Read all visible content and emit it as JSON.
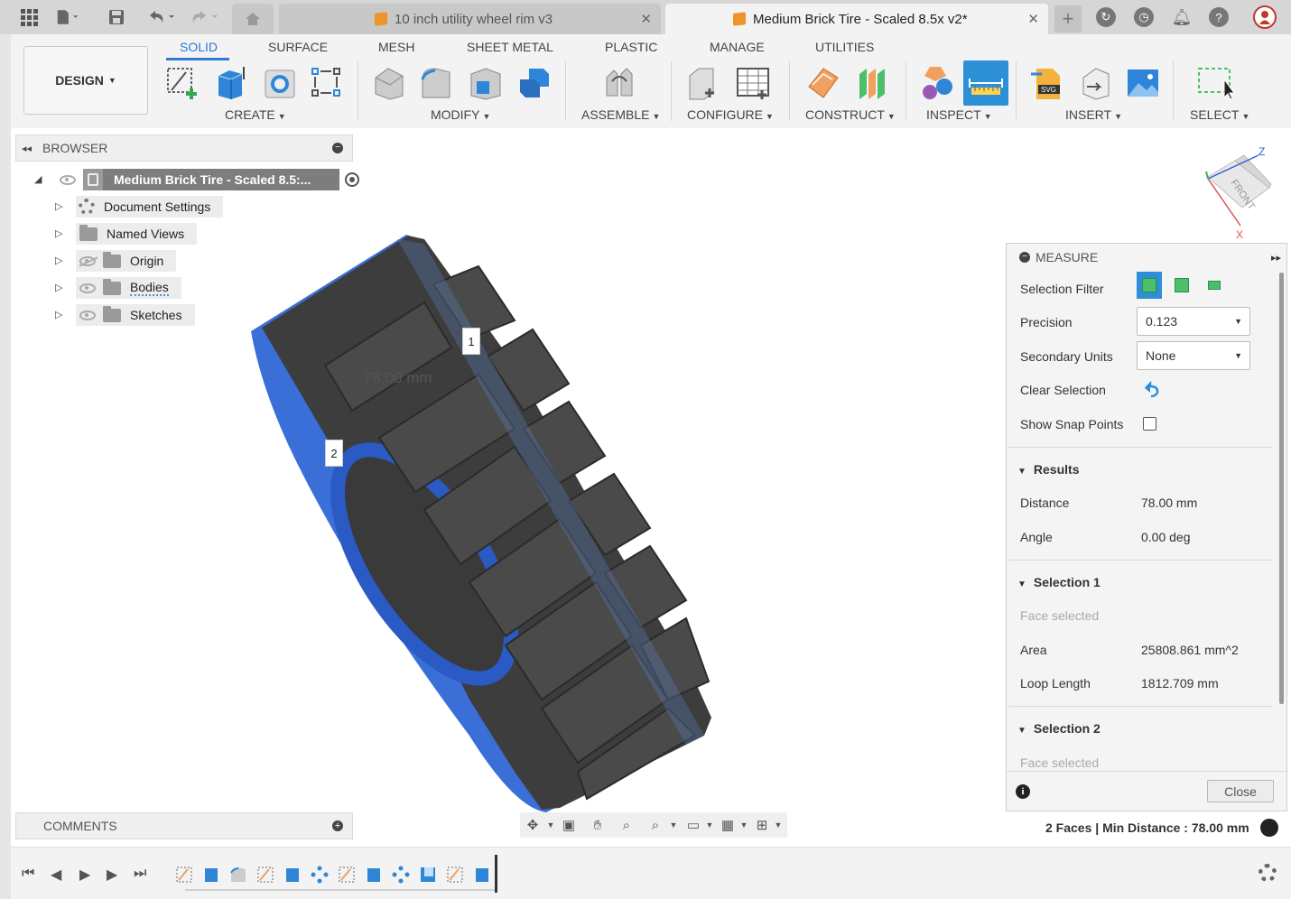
{
  "tabs": {
    "inactive_title": "10 inch utility wheel rim v3",
    "active_title": "Medium Brick Tire - Scaled 8.5x v2*"
  },
  "toolbar": {
    "design_label": "DESIGN",
    "workspace_tabs": [
      "SOLID",
      "SURFACE",
      "MESH",
      "SHEET METAL",
      "PLASTIC",
      "MANAGE",
      "UTILITIES"
    ],
    "groups": {
      "create": "CREATE",
      "modify": "MODIFY",
      "assemble": "ASSEMBLE",
      "configure": "CONFIGURE",
      "construct": "CONSTRUCT",
      "inspect": "INSPECT",
      "insert": "INSERT",
      "select": "SELECT"
    }
  },
  "browser": {
    "title": "BROWSER",
    "root": "Medium Brick Tire - Scaled 8.5:...",
    "items": [
      "Document Settings",
      "Named Views",
      "Origin",
      "Bodies",
      "Sketches"
    ]
  },
  "viewcube": {
    "face": "FRONT",
    "axis_z": "Z"
  },
  "viewport": {
    "dimension": "78.00 mm",
    "point1": "1",
    "point2": "2"
  },
  "measure": {
    "title": "MEASURE",
    "selection_filter_label": "Selection Filter",
    "precision_label": "Precision",
    "precision_value": "0.123",
    "secondary_units_label": "Secondary Units",
    "secondary_units_value": "None",
    "clear_selection_label": "Clear Selection",
    "show_snap_label": "Show Snap Points",
    "results_title": "Results",
    "distance_label": "Distance",
    "distance_value": "78.00 mm",
    "angle_label": "Angle",
    "angle_value": "0.00 deg",
    "sel1_title": "Selection 1",
    "sel1_type": "Face selected",
    "area_label": "Area",
    "area_value": "25808.861 mm^2",
    "loop_label": "Loop Length",
    "loop_value": "1812.709 mm",
    "sel2_title": "Selection 2",
    "sel2_type": "Face selected",
    "close_label": "Close"
  },
  "status": {
    "text": "2 Faces | Min Distance : 78.00 mm"
  },
  "comments": {
    "title": "COMMENTS"
  },
  "colors": {
    "accent": "#2d7bd6",
    "tire": "#3a3a3a",
    "rim_blue": "#3a6fd8"
  }
}
